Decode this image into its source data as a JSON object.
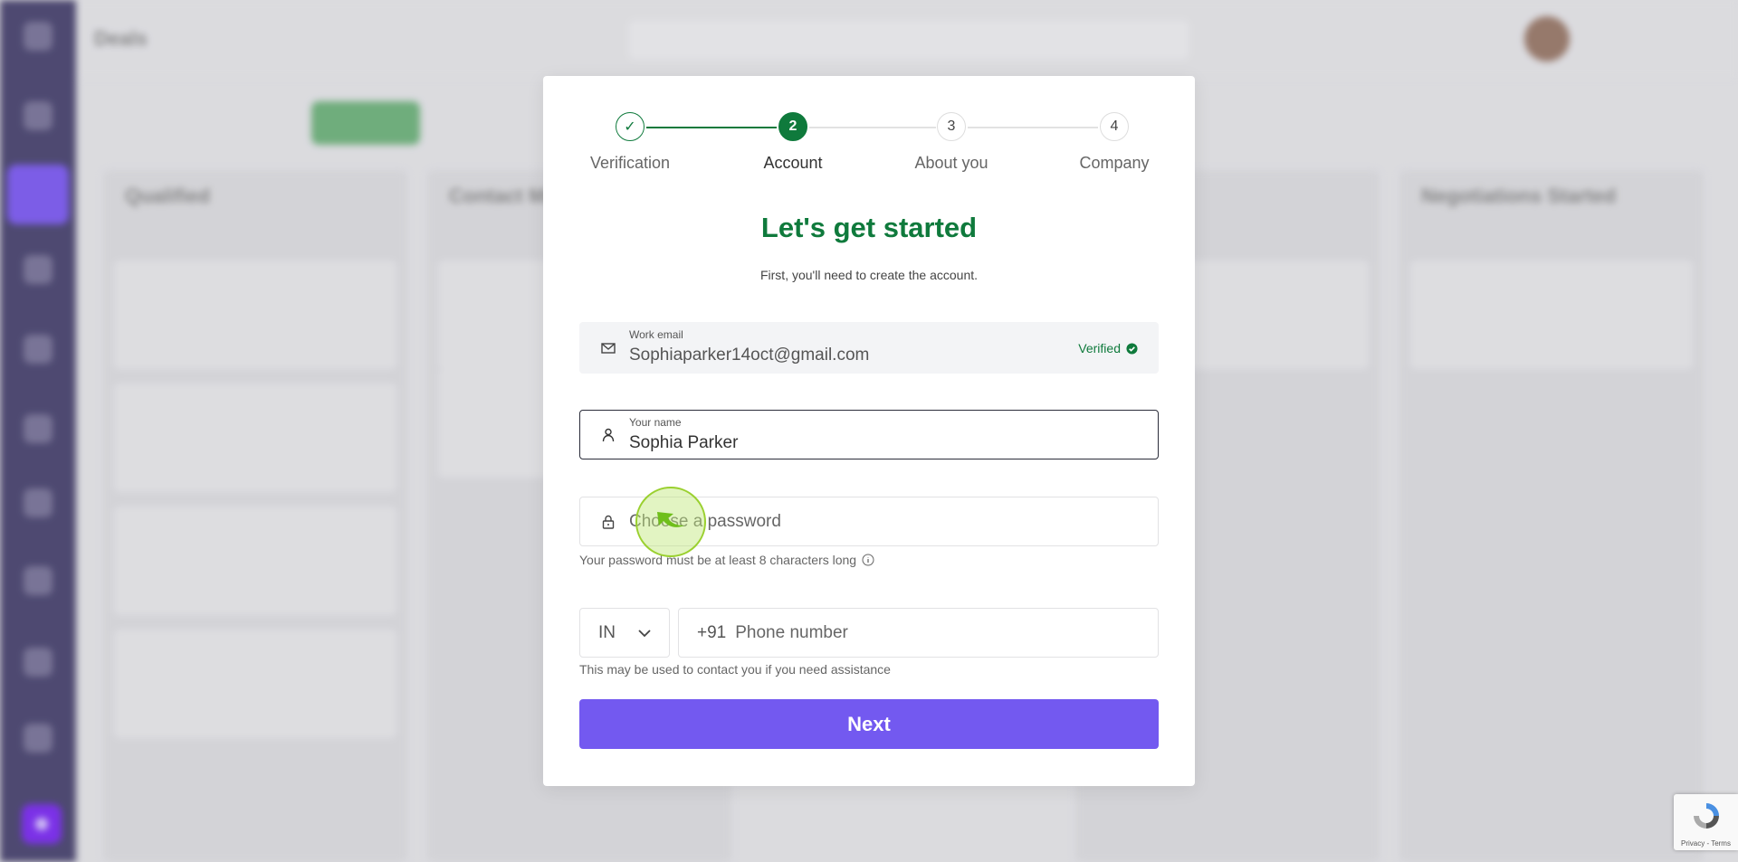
{
  "background": {
    "page_title": "Deals",
    "columns": [
      "Qualified",
      "Contact Made",
      "Negotiations Started"
    ]
  },
  "stepper": {
    "steps": [
      {
        "label": "Verification",
        "number": "✓",
        "state": "done"
      },
      {
        "label": "Account",
        "number": "2",
        "state": "active"
      },
      {
        "label": "About you",
        "number": "3",
        "state": "pending"
      },
      {
        "label": "Company",
        "number": "4",
        "state": "pending"
      }
    ]
  },
  "form": {
    "title": "Let's get started",
    "subtitle": "First, you'll need to create the account.",
    "email": {
      "label": "Work email",
      "value": "Sophiaparker14oct@gmail.com",
      "status": "Verified"
    },
    "name": {
      "label": "Your name",
      "value": "Sophia Parker"
    },
    "password": {
      "placeholder": "Choose a password",
      "hint": "Your password must be at least 8 characters long"
    },
    "phone": {
      "country": "IN",
      "prefix": "+91",
      "placeholder": "Phone number",
      "hint": "This may be used to contact you if you need assistance"
    },
    "next_label": "Next"
  },
  "recaptcha": {
    "text": "Privacy - Terms"
  },
  "colors": {
    "primary_green": "#0f7a3c",
    "button_purple": "#7359f0",
    "sidebar": "#4b4670"
  }
}
